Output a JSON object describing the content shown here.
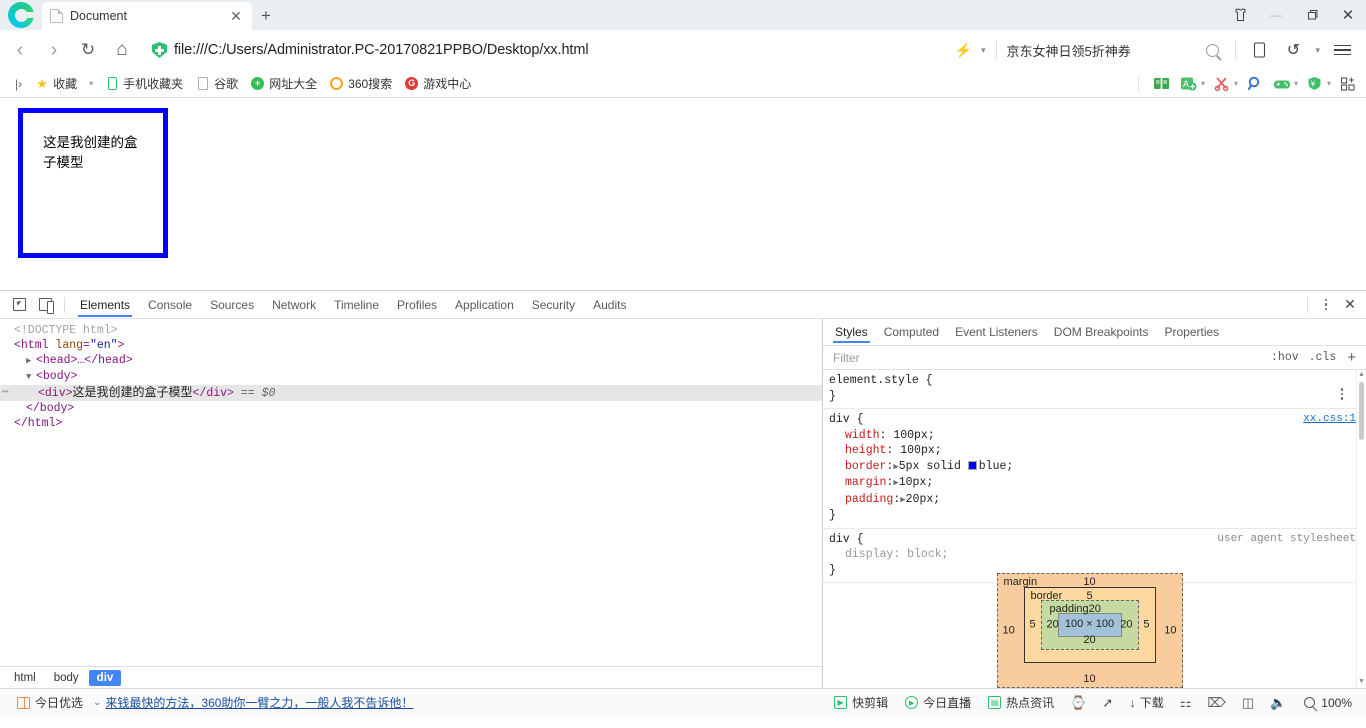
{
  "window": {
    "tab": {
      "title": "Document",
      "favicon": "document-icon",
      "close": "✕"
    },
    "new_tab": "+",
    "controls": {
      "skin": "shirt-icon",
      "minimize": "—",
      "maximize": "❐",
      "close": "✕"
    }
  },
  "nav": {
    "back": "‹",
    "forward": "›",
    "reload": "↻",
    "home": "⌂",
    "url": "file:///C:/Users/Administrator.PC-20170821PPBO/Desktop/xx.html",
    "security_icon": "shield-icon",
    "bolt": "⚡",
    "bolt_caret": "▾",
    "search_text": "京东女神日领5折神券",
    "search_icon": "magnifier-icon",
    "mobile_icon": "phone-icon",
    "history_icon": "↺",
    "history_caret": "▾",
    "menu_icon": "hamburger-icon"
  },
  "bookmarks": {
    "overflow": "|›",
    "items": [
      {
        "label": "收藏",
        "icon": "star-icon",
        "caret": "▾"
      },
      {
        "label": "手机收藏夹",
        "icon": "phone-icon"
      },
      {
        "label": "谷歌",
        "icon": "document-icon"
      },
      {
        "label": "网址大全",
        "icon": "green-plus-circle-icon"
      },
      {
        "label": "360搜索",
        "icon": "orange-ring-icon"
      },
      {
        "label": "游戏中心",
        "icon": "red-g-circle-icon"
      }
    ],
    "extensions": [
      {
        "icon": "book-icon"
      },
      {
        "icon": "translate-icon",
        "caret": "▾"
      },
      {
        "icon": "scissors-icon",
        "caret": "▾"
      },
      {
        "icon": "magnifier-icon"
      },
      {
        "icon": "gamepad-icon",
        "caret": "▾"
      },
      {
        "icon": "shield-yen-icon",
        "caret": "▾"
      },
      {
        "icon": "grid-apps-icon"
      }
    ]
  },
  "page": {
    "box_text": "这是我创建的盒子模型",
    "border_color": "#0000ff"
  },
  "devtools": {
    "inspect_icon": "inspect-element-icon",
    "device_icon": "device-toolbar-icon",
    "tabs": [
      {
        "label": "Elements",
        "selected": true
      },
      {
        "label": "Console",
        "selected": false
      },
      {
        "label": "Sources",
        "selected": false
      },
      {
        "label": "Network",
        "selected": false
      },
      {
        "label": "Timeline",
        "selected": false
      },
      {
        "label": "Profiles",
        "selected": false
      },
      {
        "label": "Application",
        "selected": false
      },
      {
        "label": "Security",
        "selected": false
      },
      {
        "label": "Audits",
        "selected": false
      }
    ],
    "more_icon": "kebab-menu-icon",
    "close_icon": "✕",
    "dom": {
      "doctype": "<!DOCTYPE html>",
      "html_open_tag": "<html",
      "html_attr_name": "lang",
      "html_attr_value": "\"en\"",
      "html_open_close": ">",
      "head_line": "<head>…</head>",
      "body_open": "<body>",
      "div_open": "<div>",
      "div_text": "这是我创建的盒子模型",
      "div_close": "</div>",
      "selected_marker": "== $0",
      "body_close": "</body>",
      "html_close": "</html>",
      "expand_collapsed": "▶",
      "expand_open": "▼",
      "dots": "⋯"
    },
    "breadcrumb": [
      {
        "label": "html",
        "selected": false
      },
      {
        "label": "body",
        "selected": false
      },
      {
        "label": "div",
        "selected": true
      }
    ],
    "styles": {
      "tabs": [
        {
          "label": "Styles",
          "selected": true
        },
        {
          "label": "Computed",
          "selected": false
        },
        {
          "label": "Event Listeners",
          "selected": false
        },
        {
          "label": "DOM Breakpoints",
          "selected": false
        },
        {
          "label": "Properties",
          "selected": false
        }
      ],
      "filter_placeholder": "Filter",
      "hov": ":hov",
      "cls": ".cls",
      "plus": "+",
      "rules": [
        {
          "selector": "element.style {",
          "closing": "}",
          "origin": "",
          "origin_is_link": false,
          "declarations": []
        },
        {
          "selector": "div {",
          "closing": "}",
          "origin": "xx.css:1",
          "origin_is_link": true,
          "declarations": [
            {
              "name": "width",
              "value": "100px;",
              "expandable": false
            },
            {
              "name": "height",
              "value": "100px;",
              "expandable": false
            },
            {
              "name": "border",
              "value": "5px solid",
              "expandable": true,
              "swatch": "#0000ff",
              "value2": "blue;"
            },
            {
              "name": "margin",
              "value": "10px;",
              "expandable": true
            },
            {
              "name": "padding",
              "value": "20px;",
              "expandable": true
            }
          ]
        },
        {
          "selector": "div {",
          "closing": "}",
          "origin": "user agent stylesheet",
          "origin_is_link": false,
          "declarations": [
            {
              "name": "display",
              "value": "block;",
              "expandable": false
            }
          ]
        }
      ]
    },
    "box_model": {
      "margin_label": "margin",
      "margin_top": "10",
      "margin_left": "10",
      "margin_right": "10",
      "margin_bottom": "10",
      "border_label": "border",
      "border_top": "5",
      "border_left": "5",
      "border_right": "5",
      "border_bottom": "5",
      "padding_label": "padding",
      "padding_top": "20",
      "padding_left": "20",
      "padding_right": "20",
      "padding_bottom": "20",
      "content": "100 × 100",
      "colors": {
        "margin": "#f9cc9d",
        "border": "#fdd9a0",
        "padding": "#c6d9a0",
        "content": "#a1c2d8"
      }
    }
  },
  "statusbar": {
    "left": [
      {
        "label": "今日优选",
        "icon": "gift-icon"
      }
    ],
    "chevron": "⌄",
    "promo": "来钱最快的方法，360助你一臂之力，一般人我不告诉他！",
    "right": [
      {
        "label": "快剪辑",
        "icon": "clip-icon"
      },
      {
        "label": "今日直播",
        "icon": "play-icon"
      },
      {
        "label": "热点资讯",
        "icon": "news-icon"
      },
      {
        "label": "",
        "icon": "clock-icon"
      },
      {
        "label": "",
        "icon": "rocket-icon"
      },
      {
        "label": "下载",
        "icon": "download-icon"
      },
      {
        "label": "",
        "icon": "flag-icon"
      },
      {
        "label": "",
        "icon": "speed-icon"
      },
      {
        "label": "",
        "icon": "window-icon"
      },
      {
        "label": "",
        "icon": "volume-icon"
      }
    ],
    "zoom": "100%",
    "zoom_icon": "magnifier-icon"
  }
}
